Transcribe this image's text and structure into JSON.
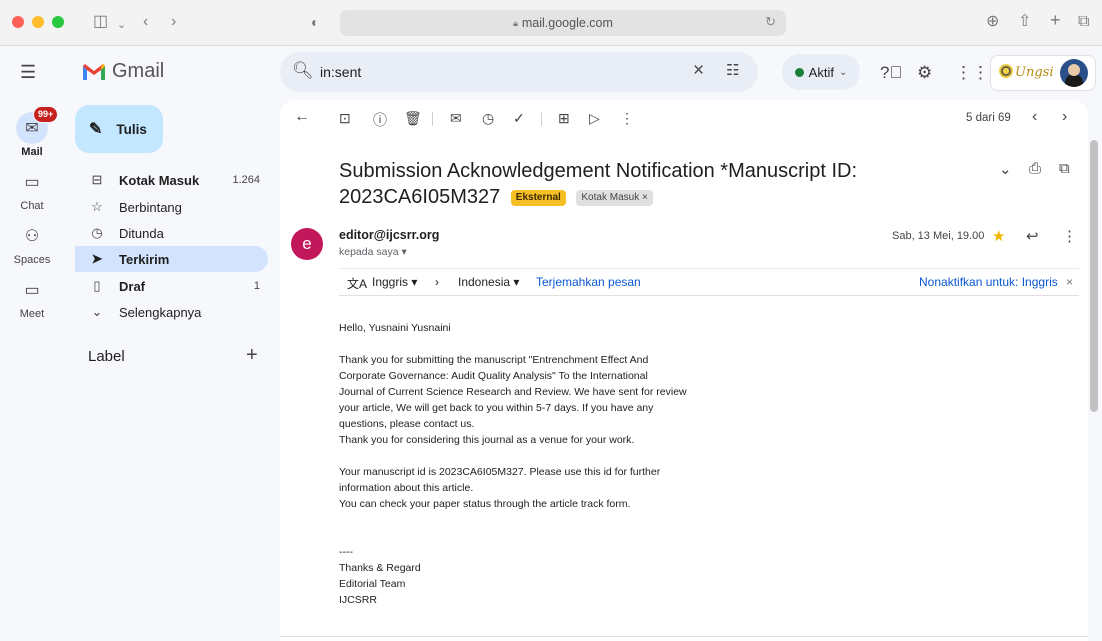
{
  "browser": {
    "url": "mail.google.com"
  },
  "gmail": {
    "app_name": "Gmail",
    "search_value": "in:sent",
    "status_label": "Aktif",
    "brand_logo_text": "Ungsi Google Apps"
  },
  "rail": {
    "items": [
      {
        "label": "Mail",
        "badge": "99+"
      },
      {
        "label": "Chat"
      },
      {
        "label": "Spaces"
      },
      {
        "label": "Meet"
      }
    ]
  },
  "nav": {
    "compose_label": "Tulis",
    "items": [
      {
        "label": "Kotak Masuk",
        "count": "1.264"
      },
      {
        "label": "Berbintang",
        "count": ""
      },
      {
        "label": "Ditunda",
        "count": ""
      },
      {
        "label": "Terkirim",
        "count": ""
      },
      {
        "label": "Draf",
        "count": "1"
      },
      {
        "label": "Selengkapnya",
        "count": ""
      }
    ],
    "label_heading": "Label"
  },
  "toolbar": {
    "pager_text": "5 dari 69"
  },
  "message": {
    "subject": "Submission Acknowledgement Notification *Manuscript ID: 2023CA6I05M327",
    "chip_external": "Eksternal",
    "chip_inbox": "Kotak Masuk ×",
    "sender_initial": "e",
    "sender_email": "editor@ijcsrr.org",
    "to_line": "kepada saya ▾",
    "date": "Sab, 13 Mei, 19.00",
    "translate": {
      "from_lang": "Inggris ▾",
      "to_lang": "Indonesia ▾",
      "translate_link": "Terjemahkan pesan",
      "disable_link": "Nonaktifkan untuk: Inggris",
      "close": "×"
    },
    "body": {
      "greeting": "Hello, Yusnaini Yusnaini",
      "para1": [
        "Thank you for submitting the manuscript \"Entrenchment Effect And",
        "Corporate Governance:  Audit Quality Analysis\" To the International",
        "Journal of Current Science Research and Review. We have sent for review",
        "your article, We will get back to you within 5-7 days. If you have any",
        "questions, please contact us.",
        "Thank you for considering this journal as a venue for your work."
      ],
      "para2": [
        "Your manuscript id is 2023CA6I05M327. Please use this id for further",
        "information about this article.",
        "You can check your paper status through the article track form."
      ],
      "signature": [
        "----",
        "Thanks & Regard",
        "Editorial Team",
        "IJCSRR"
      ]
    }
  },
  "colors": {
    "accent_blue": "#0b57d0",
    "compose_bg": "#c2e7ff",
    "active_nav_bg": "#d3e3fd",
    "external_chip": "#f6bf26",
    "sender_avatar": "#c2185b",
    "status_green": "#188038"
  }
}
